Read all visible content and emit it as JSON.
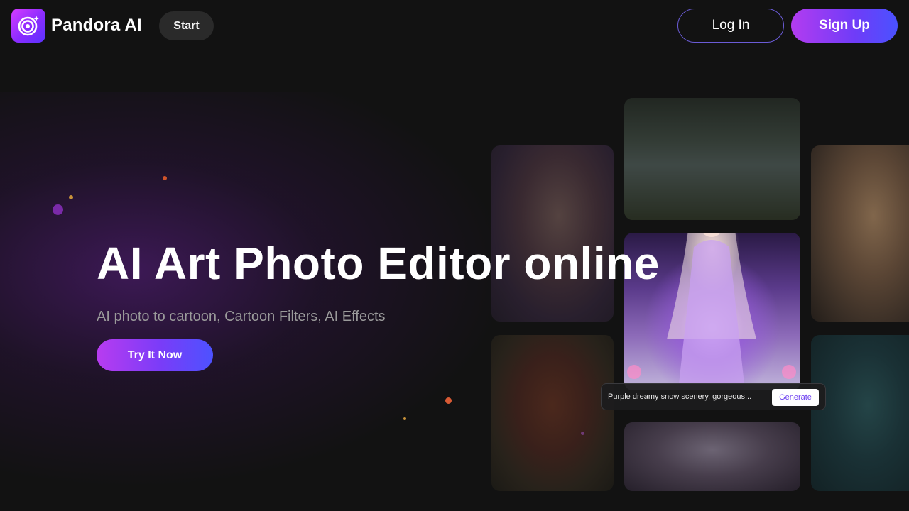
{
  "header": {
    "brand": "Pandora AI",
    "logo_icon": "spiral-logo-icon",
    "start_label": "Start",
    "login_label": "Log In",
    "signup_label": "Sign Up"
  },
  "hero": {
    "title": "AI Art Photo Editor online",
    "subtitle": "AI photo to cartoon, Cartoon Filters, AI Effects",
    "cta_label": "Try It Now"
  },
  "gallery": {
    "prompt_text": "Purple dreamy snow scenery, gorgeous...",
    "generate_label": "Generate"
  },
  "colors": {
    "background": "#121212",
    "accent_purple": "#b33cf0",
    "accent_blue": "#4a52ff",
    "subtitle_gray": "#9a9a9a"
  }
}
